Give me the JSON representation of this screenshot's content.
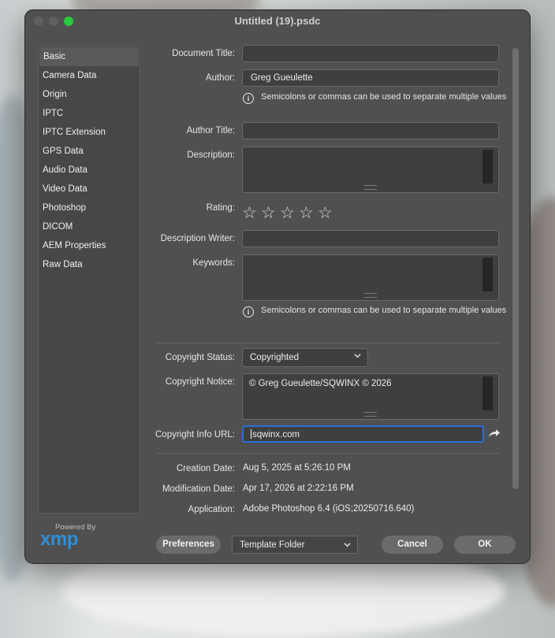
{
  "window": {
    "title": "Untitled (19).psdc"
  },
  "colors": {
    "close": "#5f5f5f",
    "minimize": "#5f5f5f",
    "zoom": "#27c93f",
    "accent": "#2a6fd6",
    "xmp": "#2f8fd8"
  },
  "sidebar": {
    "items": [
      {
        "label": "Basic"
      },
      {
        "label": "Camera Data"
      },
      {
        "label": "Origin"
      },
      {
        "label": "IPTC"
      },
      {
        "label": "IPTC Extension"
      },
      {
        "label": "GPS Data"
      },
      {
        "label": "Audio Data"
      },
      {
        "label": "Video Data"
      },
      {
        "label": "Photoshop"
      },
      {
        "label": "DICOM"
      },
      {
        "label": "AEM Properties"
      },
      {
        "label": "Raw Data"
      }
    ],
    "selected": "Basic"
  },
  "branding": {
    "powered_by": "Powered By",
    "logo": "xmp"
  },
  "form": {
    "document_title": {
      "label": "Document Title:",
      "value": ""
    },
    "author": {
      "label": "Author:",
      "value": "Greg Gueulette"
    },
    "author_hint": "Semicolons or commas can be used to separate multiple values",
    "author_title": {
      "label": "Author Title:",
      "value": ""
    },
    "description": {
      "label": "Description:",
      "value": ""
    },
    "rating": {
      "label": "Rating:",
      "value": 0,
      "max": 5
    },
    "description_writer": {
      "label": "Description Writer:",
      "value": ""
    },
    "keywords": {
      "label": "Keywords:",
      "value": ""
    },
    "keywords_hint": "Semicolons or commas can be used to separate multiple values",
    "copyright_status": {
      "label": "Copyright Status:",
      "value": "Copyrighted"
    },
    "copyright_notice": {
      "label": "Copyright Notice:",
      "value": "© Greg Gueulette/SQWINX © 2026"
    },
    "copyright_url": {
      "label": "Copyright Info URL:",
      "value": "sqwinx.com"
    },
    "creation_date": {
      "label": "Creation Date:",
      "value": "Aug 5, 2025 at 5:26:10 PM"
    },
    "modification_date": {
      "label": "Modification Date:",
      "value": "Apr 17, 2026 at 2:22:16 PM"
    },
    "application": {
      "label": "Application:",
      "value": "Adobe Photoshop 6.4 (iOS;20250716.640)"
    }
  },
  "footer": {
    "preferences": "Preferences",
    "template_folder": "Template Folder",
    "cancel": "Cancel",
    "ok": "OK"
  }
}
